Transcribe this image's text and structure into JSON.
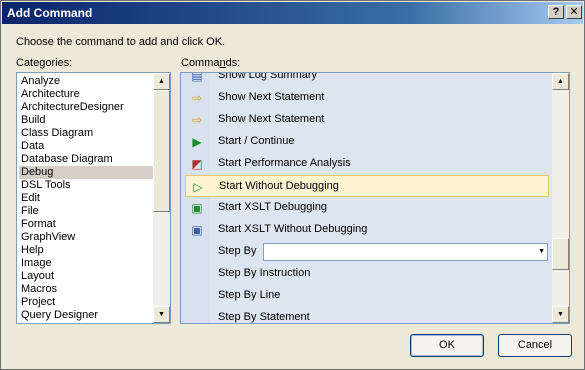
{
  "window": {
    "title": "Add Command",
    "help_label": "?",
    "close_label": "✕"
  },
  "prompt": "Choose the command to add and click OK.",
  "categories": {
    "label_pre": "Categories:",
    "items": [
      "Analyze",
      "Architecture",
      "ArchitectureDesigner",
      "Build",
      "Class Diagram",
      "Data",
      "Database Diagram",
      "Debug",
      "DSL Tools",
      "Edit",
      "File",
      "Format",
      "GraphView",
      "Help",
      "Image",
      "Layout",
      "Macros",
      "Project",
      "Query Designer"
    ],
    "selected": "Debug",
    "scroll_up": "▲",
    "scroll_down": "▼"
  },
  "commands": {
    "label_pre": "Comma",
    "label_ul": "n",
    "label_post": "ds:",
    "items": [
      {
        "label": "Show Log Summary",
        "icon": "log-icon"
      },
      {
        "label": "Show Next Statement",
        "icon": "arrow-right-icon"
      },
      {
        "label": "Show Next Statement",
        "icon": "arrow-right-icon"
      },
      {
        "label": "Start / Continue",
        "icon": "play-icon"
      },
      {
        "label": "Start Performance Analysis",
        "icon": "performance-icon"
      },
      {
        "label": "Start Without Debugging",
        "icon": "play-no-debug-icon"
      },
      {
        "label": "Start XSLT Debugging",
        "icon": "xslt-debug-icon"
      },
      {
        "label": "Start XSLT Without Debugging",
        "icon": "xslt-no-debug-icon"
      },
      {
        "label": "Step By",
        "icon": "",
        "combo_value": ""
      },
      {
        "label": "Step By Instruction",
        "icon": ""
      },
      {
        "label": "Step By Line",
        "icon": ""
      },
      {
        "label": "Step By Statement",
        "icon": ""
      }
    ],
    "selected": "Start Without Debugging",
    "combo_arrow": "▼"
  },
  "buttons": {
    "ok": "OK",
    "cancel": "Cancel"
  }
}
